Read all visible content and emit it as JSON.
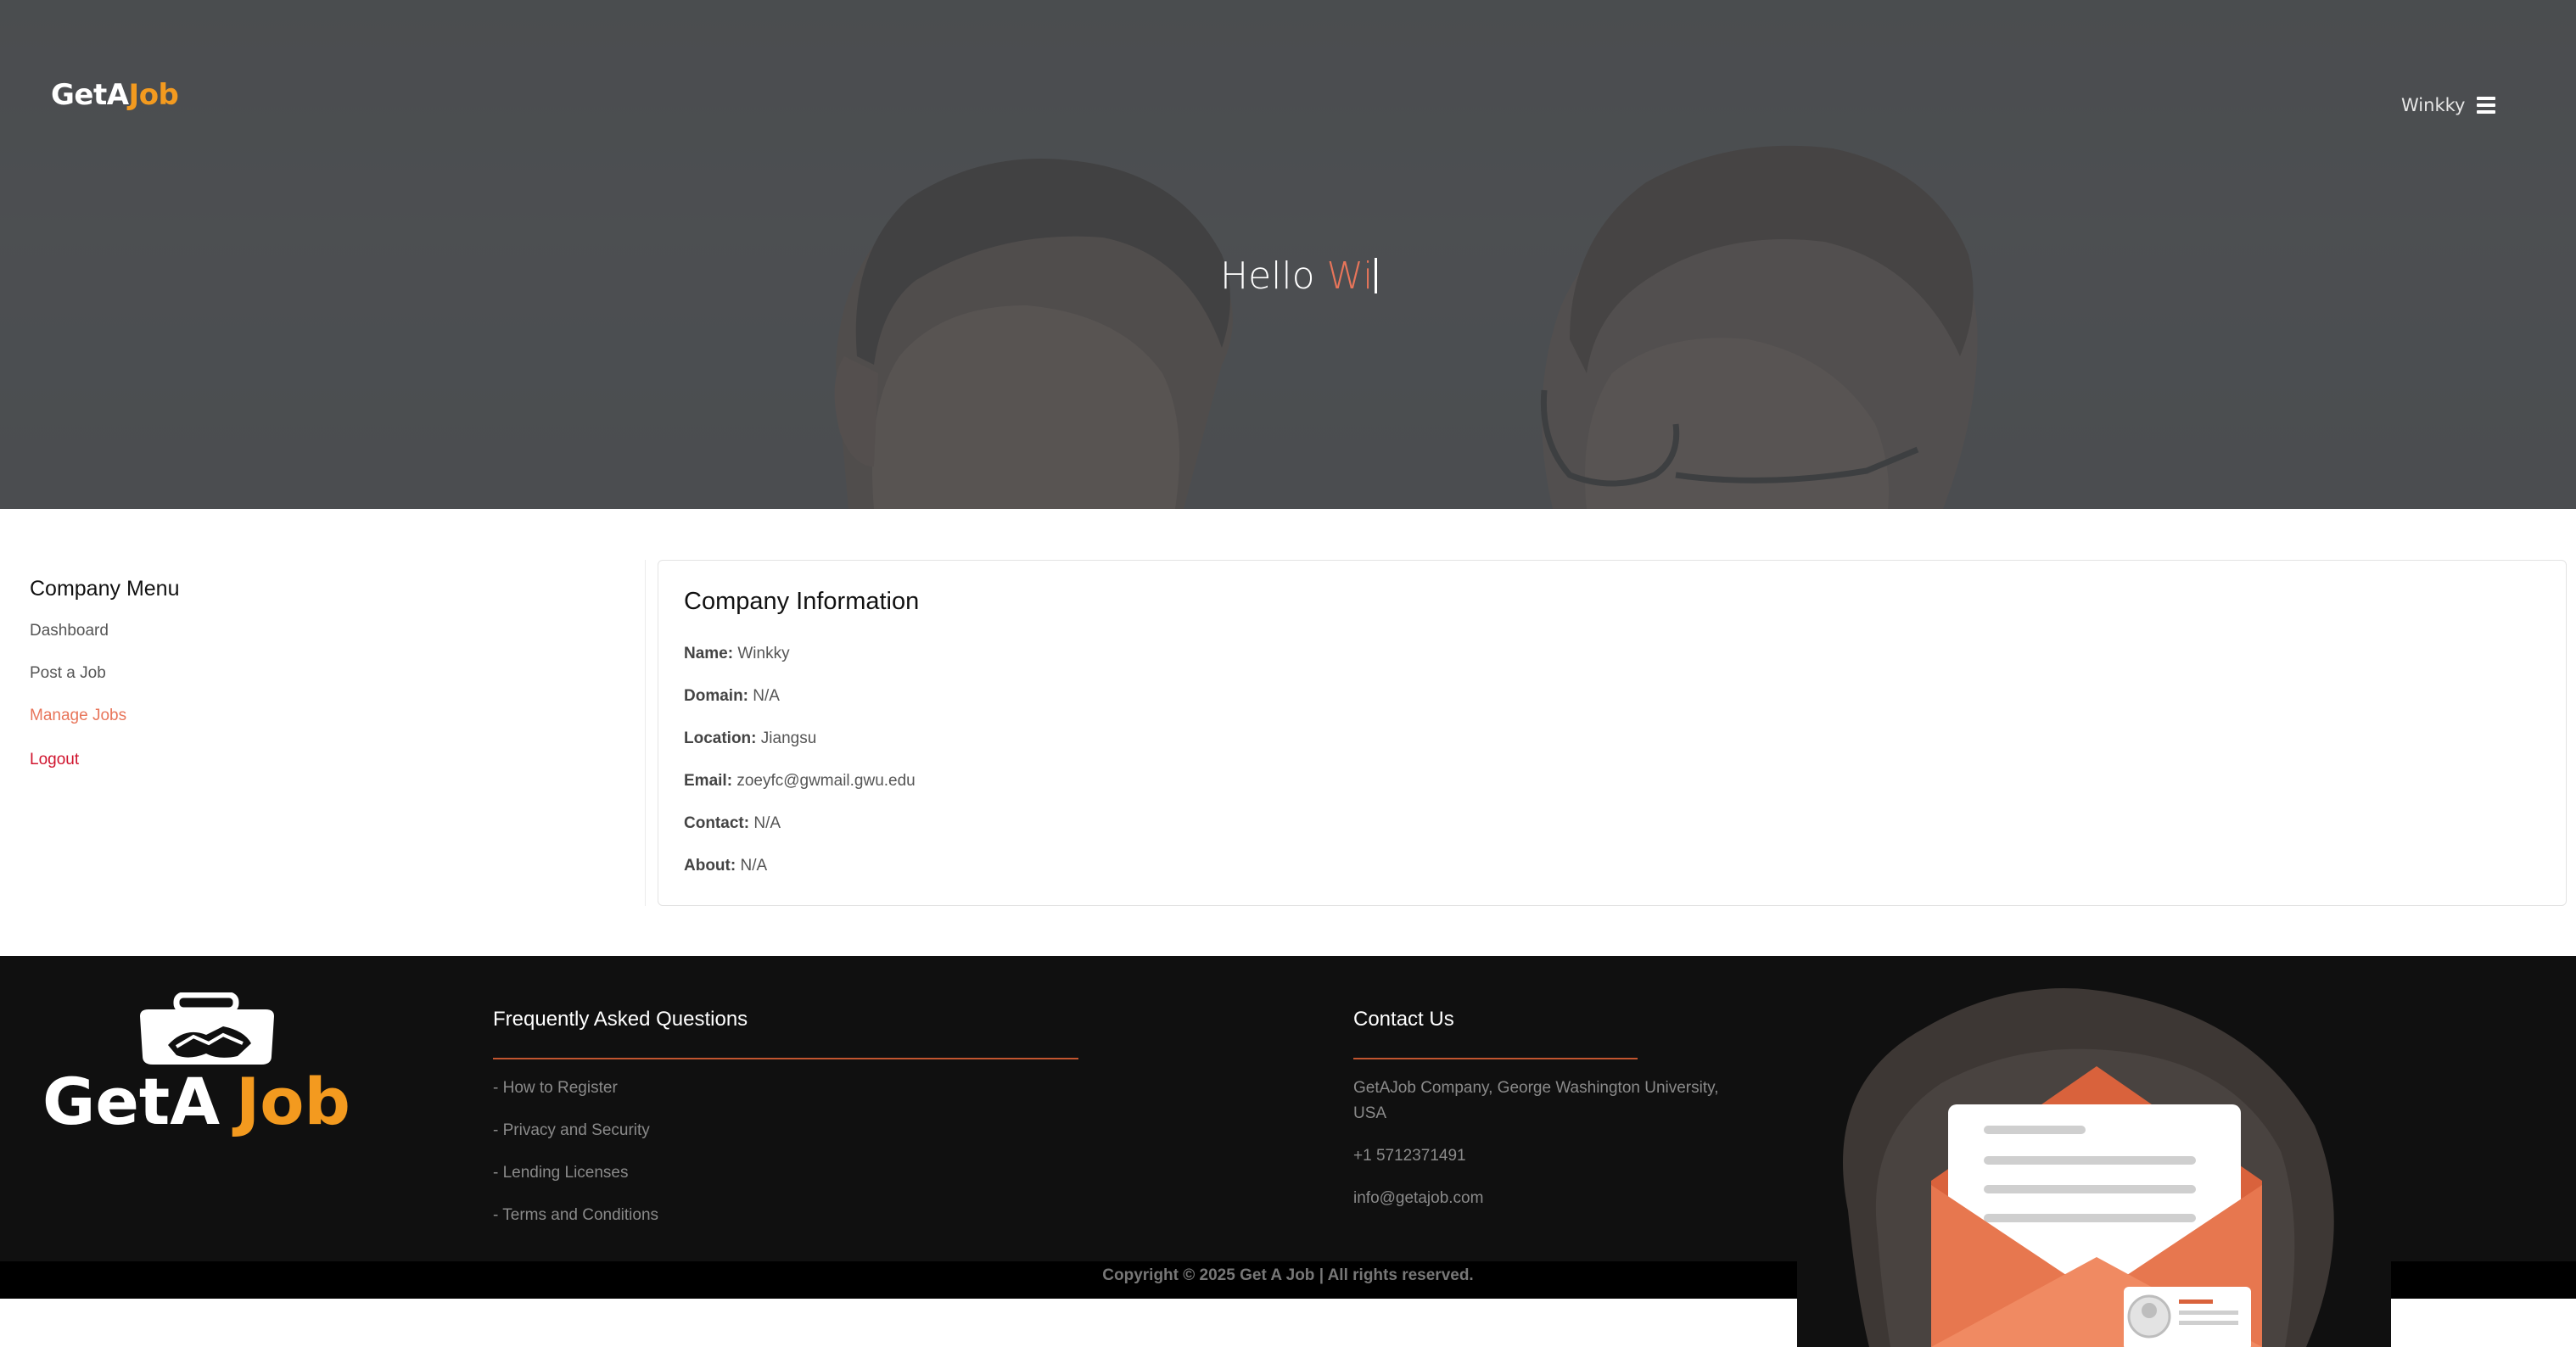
{
  "header": {
    "brand_part1": "GetA",
    "brand_part2": "Job",
    "user_name": "Winkky",
    "menu_icon": "hamburger-menu-icon"
  },
  "hero": {
    "greeting": "Hello",
    "typed_name": "Wi"
  },
  "sidebar": {
    "title": "Company Menu",
    "items": [
      {
        "label": "Dashboard"
      },
      {
        "label": "Post a Job"
      },
      {
        "label": "Manage Jobs"
      },
      {
        "label": "Logout"
      }
    ]
  },
  "company": {
    "title": "Company Information",
    "fields": [
      {
        "label": "Name:",
        "value": "Winkky"
      },
      {
        "label": "Domain:",
        "value": "N/A"
      },
      {
        "label": "Location:",
        "value": "Jiangsu"
      },
      {
        "label": "Email:",
        "value": "zoeyfc@gwmail.gwu.edu"
      },
      {
        "label": "Contact:",
        "value": "N/A"
      },
      {
        "label": "About:",
        "value": "N/A"
      }
    ]
  },
  "footer": {
    "logo_part1": "GetA",
    "logo_part2": "Job",
    "faq": {
      "title": "Frequently Asked Questions",
      "links": [
        {
          "label": "- How to Register"
        },
        {
          "label": "- Privacy and Security"
        },
        {
          "label": "- Lending Licenses"
        },
        {
          "label": "- Terms and Conditions"
        }
      ]
    },
    "contact": {
      "title": "Contact Us",
      "address_line1": "GetAJob Company, George Washington University,",
      "address_line2": "USA",
      "phone": "+1 5712371491",
      "email": "info@getajob.com"
    },
    "copyright": "Copyright © 2025 Get A Job | All rights reserved."
  },
  "colors": {
    "accent": "#e8755a",
    "brand_orange": "#f39a1f",
    "logout_red": "#d0142e",
    "footer_bg": "#101010"
  }
}
